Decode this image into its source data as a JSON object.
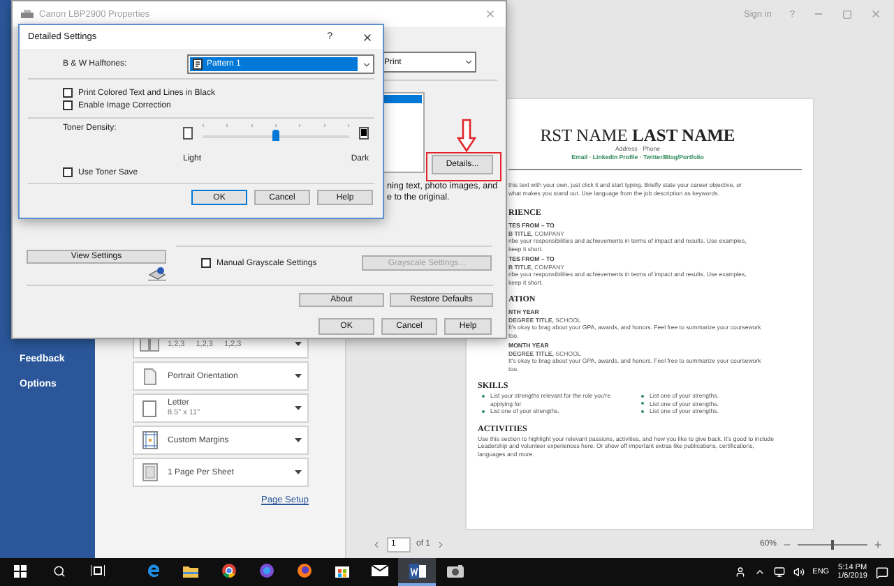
{
  "word": {
    "top_bar": {
      "sign_in": "Sign in",
      "help": "?"
    },
    "sidebar": [
      {
        "label": "Feedback"
      },
      {
        "label": "Options"
      }
    ],
    "print_settings": [
      {
        "kind": "collate",
        "pages": [
          "1,2,3",
          "1,2,3",
          "1,2,3"
        ]
      },
      {
        "kind": "portrait",
        "title": "Portrait Orientation"
      },
      {
        "kind": "paper",
        "title": "Letter",
        "subtitle": "8.5\" x 11\""
      },
      {
        "kind": "margins",
        "title": "Custom Margins"
      },
      {
        "kind": "sheet",
        "title": "1 Page Per Sheet"
      }
    ],
    "page_setup_link": "Page Setup",
    "resume": {
      "name": "RST NAME **LAST NAME**",
      "contact": "Address · Phone",
      "links": "Email · LinkedIn Profile · Twitter/Blog/Portfolio",
      "objective": [
        "this text with your own, just click it and start typing. Briefly state your career objective, or",
        "what makes you stand out. Use language from the job description as keywords."
      ],
      "sections": [
        {
          "kind": "entries",
          "heading": "RIENCE",
          "entries": [
            {
              "date": "TES FROM – TO",
              "title": "**B TITLE,** COMPANY",
              "text": [
                "ribe your responsibilities and achievements in terms of impact and results. Use examples,",
                "keep it short."
              ]
            },
            {
              "date": "TES FROM – TO",
              "title": "**B TITLE,** COMPANY",
              "text": [
                "ribe your responsibilities and achievements in terms of impact and results. Use examples,",
                "keep it short."
              ]
            }
          ]
        },
        {
          "kind": "entries",
          "heading": "ATION",
          "entries": [
            {
              "date": "NTH YEAR",
              "title": "**DEGREE TITLE,** SCHOOL",
              "text": [
                "It's okay to brag about your GPA, awards, and honors. Feel free to summarize your coursework",
                "too."
              ]
            },
            {
              "date": "MONTH YEAR",
              "title": "**DEGREE TITLE,** SCHOOL",
              "text": [
                "It's okay to brag about your GPA, awards, and honors. Feel free to summarize your coursework",
                "too."
              ]
            }
          ]
        },
        {
          "kind": "bullets",
          "heading": "SKILLS",
          "columns": [
            [
              "List your strengths relevant for the role you're applying for",
              "List one of your strengths."
            ],
            [
              "List one of your strengths.",
              "List one of your strengths.",
              "List one of your strengths."
            ]
          ]
        },
        {
          "kind": "paragraph",
          "heading": "ACTIVITIES",
          "text": "Use this section to highlight your relevant passions, activities, and how you like to give back. It's good to include Leadership and volunteer experiences here. Or show off important extras like publications, certifications, languages and more."
        }
      ]
    },
    "page_nav": {
      "page": "1",
      "of": "of 1"
    },
    "zoom": {
      "label": "60%",
      "level": 0.5
    }
  },
  "properties_dialog": {
    "title": "Canon LBP2900 Properties",
    "mode_select": "Print",
    "details_button": "Details...",
    "description_lines": [
      "ning text, photo images, and",
      "e to the original."
    ],
    "view_settings_button": "View Settings",
    "manual_grayscale": {
      "label": "Manual Grayscale Settings",
      "checked": false
    },
    "grayscale_button": {
      "label": "Grayscale Settings...",
      "disabled": true
    },
    "about_button": "About",
    "restore_button": "Restore Defaults",
    "buttons": [
      "OK",
      "Cancel",
      "Help"
    ]
  },
  "detailed_settings": {
    "title": "Detailed Settings",
    "help": "?",
    "halftones": {
      "label": "B & W Halftones:",
      "value": "Pattern 1"
    },
    "checkboxes": [
      {
        "label": "Print Colored Text and Lines in Black",
        "checked": false
      },
      {
        "label": "Enable Image Correction",
        "checked": false
      }
    ],
    "toner_density": {
      "label": "Toner Density:",
      "level": 0.5,
      "min_label": "Light",
      "max_label": "Dark"
    },
    "toner_save": {
      "label": "Use Toner Save",
      "checked": false
    },
    "buttons": [
      "OK",
      "Cancel",
      "Help"
    ]
  },
  "taskbar": {
    "apps": [
      {
        "kind": "edge",
        "selected": false
      },
      {
        "kind": "folder",
        "selected": false
      },
      {
        "kind": "chrome",
        "selected": false
      },
      {
        "kind": "purple",
        "selected": false
      },
      {
        "kind": "firefox",
        "selected": false
      },
      {
        "kind": "store",
        "selected": false
      },
      {
        "kind": "mail",
        "selected": false
      },
      {
        "kind": "word",
        "selected": true
      },
      {
        "kind": "camera",
        "selected": false
      }
    ],
    "language": "ENG",
    "time": "5:14 PM",
    "date": "1/6/2019"
  }
}
